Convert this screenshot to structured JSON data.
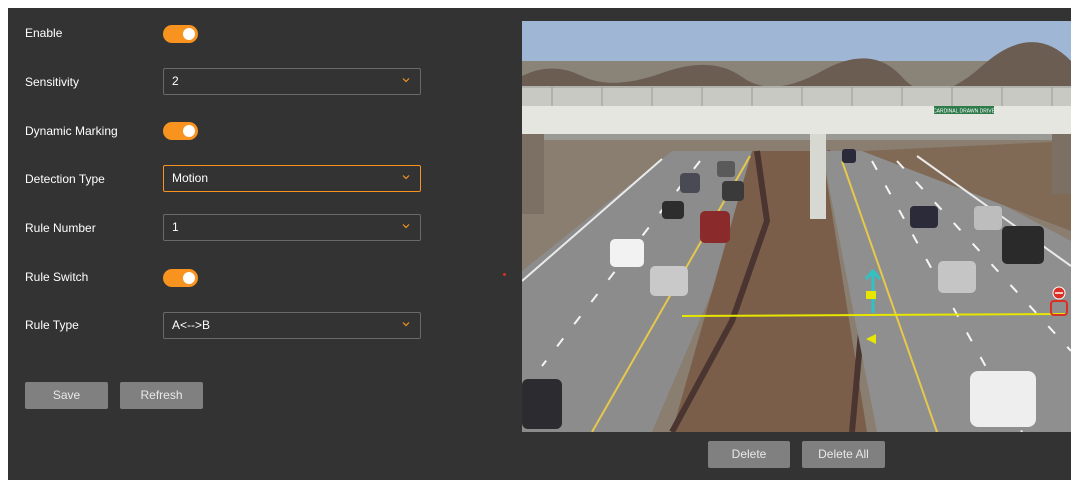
{
  "settings": {
    "enable": {
      "label": "Enable",
      "on": true
    },
    "sensitivity": {
      "label": "Sensitivity",
      "value": "2"
    },
    "dynamic_marking": {
      "label": "Dynamic Marking",
      "on": true
    },
    "detection_type": {
      "label": "Detection Type",
      "value": "Motion"
    },
    "rule_number": {
      "label": "Rule Number",
      "value": "1"
    },
    "rule_switch": {
      "label": "Rule Switch",
      "on": true
    },
    "rule_type": {
      "label": "Rule Type",
      "value": "A<-->B"
    }
  },
  "buttons": {
    "save": "Save",
    "refresh": "Refresh",
    "delete": "Delete",
    "delete_all": "Delete All"
  },
  "video": {
    "overpass_sign": "CARDINAL DRAWN DRIVE"
  },
  "colors": {
    "accent": "#f7931e",
    "panel": "#333333",
    "button": "#808080",
    "rule_line": "#e6e600",
    "arrow": "#2ec4c4"
  },
  "icons": [
    "chevron-down-icon",
    "direction-arrow-icon",
    "rule-endpoint-marker-icon"
  ]
}
